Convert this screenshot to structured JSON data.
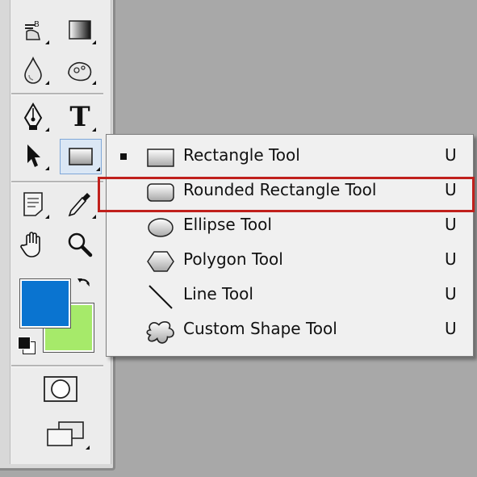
{
  "flyout": {
    "items": [
      {
        "label": "Rectangle Tool",
        "shortcut": "U",
        "icon": "rectangle-icon",
        "selected": true
      },
      {
        "label": "Rounded Rectangle Tool",
        "shortcut": "U",
        "icon": "rounded-rectangle-icon",
        "selected": false
      },
      {
        "label": "Ellipse Tool",
        "shortcut": "U",
        "icon": "ellipse-icon",
        "selected": false
      },
      {
        "label": "Polygon Tool",
        "shortcut": "U",
        "icon": "polygon-icon",
        "selected": false
      },
      {
        "label": "Line Tool",
        "shortcut": "U",
        "icon": "line-icon",
        "selected": false
      },
      {
        "label": "Custom Shape Tool",
        "shortcut": "U",
        "icon": "custom-shape-icon",
        "selected": false
      }
    ],
    "highlighted_item": "Rounded Rectangle Tool",
    "highlight_color": "#c0201c"
  },
  "toolbox": {
    "text_tool_glyph": "T",
    "swap_glyph": "↶",
    "foreground_color": "#0a74d0",
    "background_color": "#a6ea6a",
    "active_tool": "rectangle-shape-tool"
  }
}
